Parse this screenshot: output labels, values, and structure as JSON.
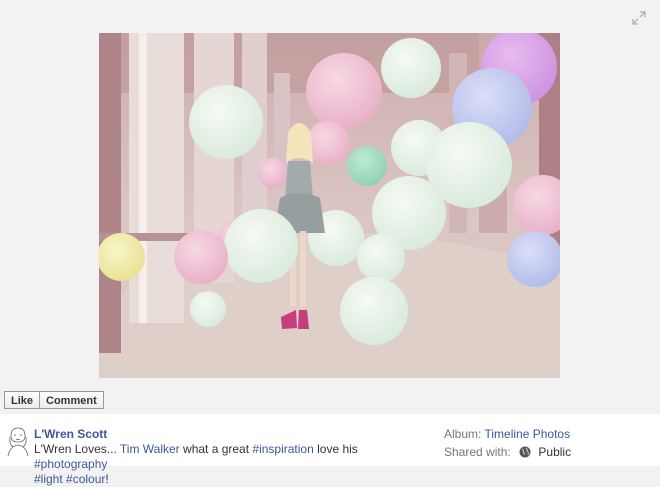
{
  "photo": {
    "colors": {
      "page_bg": "#f2f2f2",
      "link": "#3b5998"
    }
  },
  "actions": {
    "like_label": "Like",
    "comment_label": "Comment"
  },
  "post": {
    "author": "L'Wren Scott",
    "caption_prefix": "L'Wren Loves... ",
    "tagged": "Tim Walker",
    "caption_mid1": " what a great ",
    "hashtag1": "#inspiration",
    "caption_mid2": " love his ",
    "hashtag2": "#photography",
    "hashtag3": "#light",
    "hashtag4": "#colour",
    "caption_end": "!"
  },
  "meta": {
    "album_label": "Album:",
    "album_name": "Timeline Photos",
    "shared_label": "Shared with:",
    "privacy": "Public"
  },
  "icons": [
    "expand-icon",
    "globe-icon",
    "avatar"
  ]
}
